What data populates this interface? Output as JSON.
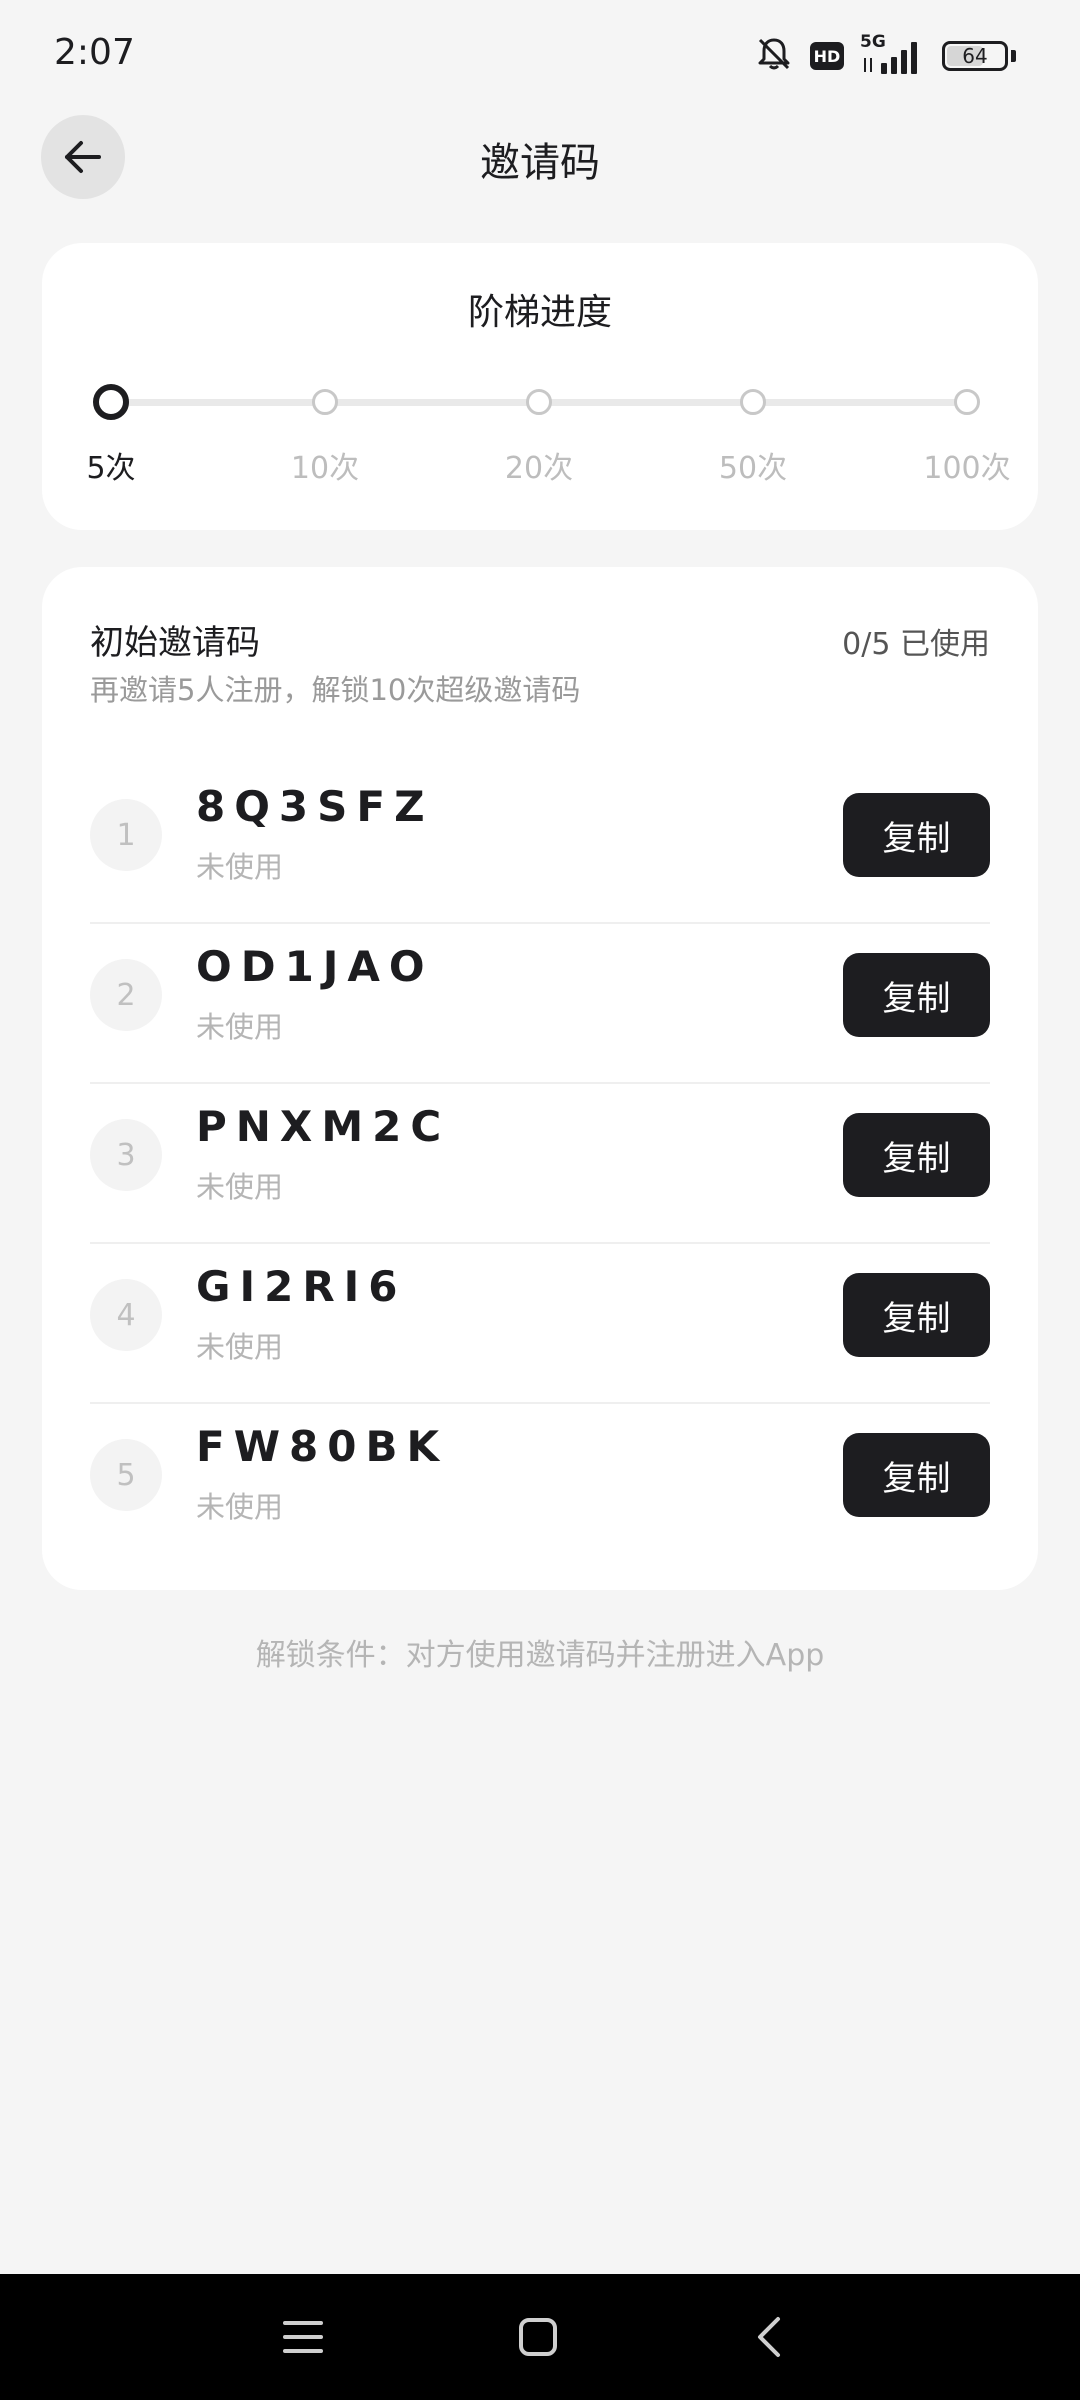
{
  "status_bar": {
    "time": "2:07",
    "hd_label": "HD",
    "network_label": "5G",
    "battery_level": "64"
  },
  "header": {
    "title": "邀请码",
    "back_icon": "arrow-left-icon"
  },
  "progress": {
    "title": "阶梯进度",
    "current_step_index": 0,
    "steps": [
      {
        "label": "5次"
      },
      {
        "label": "10次"
      },
      {
        "label": "20次"
      },
      {
        "label": "50次"
      },
      {
        "label": "100次"
      }
    ]
  },
  "codes_card": {
    "title": "初始邀请码",
    "usage": "0/5 已使用",
    "subtitle": "再邀请5人注册，解锁10次超级邀请码",
    "rows": [
      {
        "index": "1",
        "code": "8Q3SFZ",
        "status": "未使用",
        "button": "复制"
      },
      {
        "index": "2",
        "code": "OD1JAO",
        "status": "未使用",
        "button": "复制"
      },
      {
        "index": "3",
        "code": "PNXM2C",
        "status": "未使用",
        "button": "复制"
      },
      {
        "index": "4",
        "code": "GI2RI6",
        "status": "未使用",
        "button": "复制"
      },
      {
        "index": "5",
        "code": "FW80BK",
        "status": "未使用",
        "button": "复制"
      }
    ]
  },
  "footer_note": "解锁条件：对方使用邀请码并注册进入App",
  "nav_bar": {
    "icons": [
      "menu-icon",
      "home-icon",
      "back-icon"
    ]
  },
  "colors": {
    "background": "#f5f5f5",
    "card": "#ffffff",
    "primary_dark": "#1d1d20",
    "muted_text": "#b5b5b5",
    "nav_bar": "#000000"
  }
}
